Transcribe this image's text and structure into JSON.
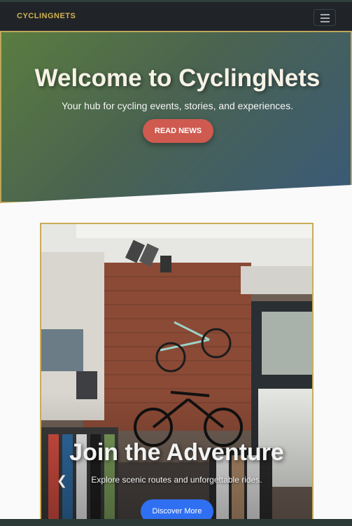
{
  "navbar": {
    "brand": "CYCLINGNETS",
    "toggler_icon": "hamburger-menu-icon"
  },
  "hero": {
    "title": "Welcome to CyclingNets",
    "subtitle": "Your hub for cycling events, stories, and experiences.",
    "button_label": "READ NEWS"
  },
  "carousel": {
    "title": "Join the Adventure",
    "subtitle": "Explore scenic routes and unforgettable rides.",
    "button_label": "Discover More",
    "prev_icon": "chevron-left-icon"
  },
  "colors": {
    "brand": "#d3b24e",
    "hero_button": "#cf5a4f",
    "primary_button": "#2f6ff2",
    "frame_border": "#c9ad57"
  }
}
